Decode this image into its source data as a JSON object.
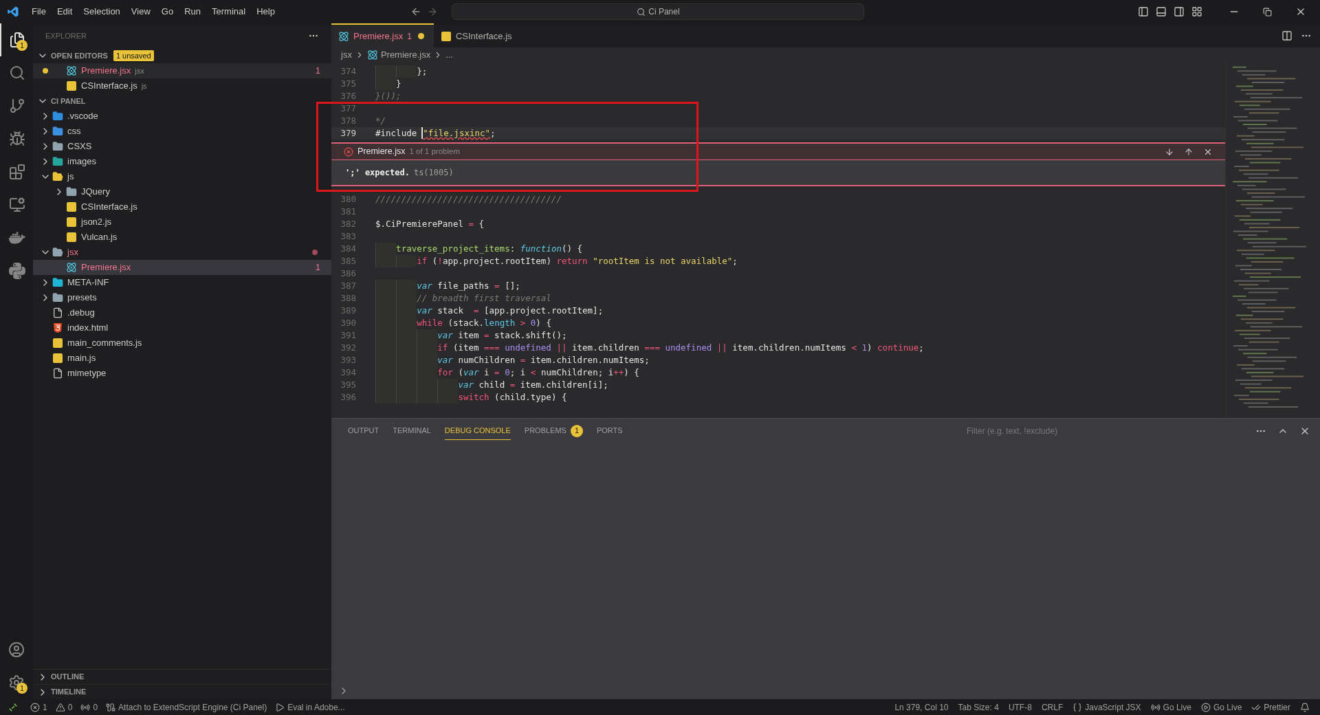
{
  "menu": [
    "File",
    "Edit",
    "Selection",
    "View",
    "Go",
    "Run",
    "Terminal",
    "Help"
  ],
  "search": "Ci Panel",
  "activity": [
    {
      "kind": "explorer",
      "selected": true,
      "badge": "1"
    },
    {
      "kind": "search",
      "selected": false
    },
    {
      "kind": "source-control",
      "selected": false
    },
    {
      "kind": "run",
      "selected": false
    },
    {
      "kind": "extensions",
      "selected": false
    },
    {
      "kind": "remote",
      "selected": false
    },
    {
      "kind": "docker",
      "selected": false
    },
    {
      "kind": "python",
      "selected": false
    }
  ],
  "activity_bottom": [
    {
      "kind": "account"
    },
    {
      "kind": "manage",
      "badge": "1"
    }
  ],
  "sidebar": {
    "title": "EXPLORER",
    "open_editors": {
      "label": "OPEN EDITORS",
      "badge": "1 unsaved",
      "expanded": true,
      "items": [
        {
          "name": "Premiere.jsx",
          "hint": "jsx",
          "kind": "react",
          "unsaved": true,
          "error": true,
          "count": "1",
          "selected": true
        },
        {
          "name": "CSInterface.js",
          "hint": "js",
          "kind": "js",
          "unsaved": false,
          "error": false,
          "selected": false
        }
      ]
    },
    "project": {
      "label": "CI PANEL",
      "expanded": true,
      "items": [
        {
          "name": ".vscode",
          "kind": "vscode-folder",
          "expanded": false,
          "selected": false
        },
        {
          "name": "css",
          "kind": "css-folder",
          "expanded": false,
          "selected": false
        },
        {
          "name": "CSXS",
          "kind": "folder",
          "expanded": false,
          "selected": false
        },
        {
          "name": "images",
          "kind": "images-folder",
          "expanded": false,
          "selected": false
        },
        {
          "name": "js",
          "kind": "js-folder",
          "expanded": true,
          "selected": false,
          "children": [
            {
              "name": "JQuery",
              "kind": "folder",
              "expanded": false,
              "selected": false
            },
            {
              "name": "CSInterface.js",
              "kind": "js",
              "selected": false
            },
            {
              "name": "json2.js",
              "kind": "js",
              "selected": false
            },
            {
              "name": "Vulcan.js",
              "kind": "js",
              "selected": false
            }
          ]
        },
        {
          "name": "jsx",
          "kind": "folder",
          "expanded": true,
          "selected": false,
          "error": true,
          "children": [
            {
              "name": "Premiere.jsx",
              "kind": "react",
              "selected": true,
              "error": true,
              "count": "1"
            }
          ]
        },
        {
          "name": "META-INF",
          "kind": "meta-folder",
          "expanded": false,
          "selected": false
        },
        {
          "name": "presets",
          "kind": "folder",
          "expanded": false,
          "selected": false
        },
        {
          "name": ".debug",
          "kind": "file",
          "selected": false
        },
        {
          "name": "index.html",
          "kind": "html",
          "selected": false
        },
        {
          "name": "main_comments.js",
          "kind": "js",
          "selected": false
        },
        {
          "name": "main.js",
          "kind": "js",
          "selected": false
        },
        {
          "name": "mimetype",
          "kind": "file",
          "selected": false
        }
      ]
    },
    "outline": "OUTLINE",
    "timeline": "TIMELINE"
  },
  "tabs": [
    {
      "label": "Premiere.jsx",
      "count": "1",
      "kind": "react",
      "selected": true,
      "error": true,
      "unsaved": true
    },
    {
      "label": "CSInterface.js",
      "kind": "js",
      "selected": false,
      "error": false,
      "unsaved": false
    }
  ],
  "breadcrumb": [
    {
      "label": "jsx"
    },
    {
      "label": "Premiere.jsx",
      "kind": "react"
    },
    {
      "label": "..."
    }
  ],
  "code_before": [
    {
      "n": "374",
      "tokens": [
        {
          "text": "        };",
          "kind": "punct"
        }
      ]
    },
    {
      "n": "375",
      "tokens": [
        {
          "text": "    }",
          "kind": "punct"
        }
      ]
    },
    {
      "n": "376",
      "tokens": [
        {
          "text": "}());",
          "kind": "comment"
        }
      ]
    },
    {
      "n": "377"
    },
    {
      "n": "378",
      "tokens": [
        {
          "text": "*/",
          "kind": "comment"
        }
      ]
    },
    {
      "n": "379",
      "current": true,
      "tokens": [
        {
          "text": "#include",
          "kind": "plain"
        },
        {
          "text": "\"file.jsxinc\"",
          "kind": "error-string"
        },
        {
          "text": ";",
          "kind": "punct"
        }
      ]
    }
  ],
  "peek": {
    "file": "Premiere.jsx",
    "count": "1 of 1 problem",
    "message": "';' expected.",
    "code": "ts(1005)"
  },
  "code_after": [
    {
      "n": "380",
      "tokens": [
        {
          "text": "////////////////////////////////////",
          "kind": "comment"
        }
      ]
    },
    {
      "n": "381"
    },
    {
      "n": "382",
      "tokens": [
        {
          "text": "$.CiPremierePanel",
          "kind": "plain"
        },
        {
          "text": " =",
          "kind": "op"
        },
        {
          "text": " {",
          "kind": "punct"
        }
      ]
    },
    {
      "n": "383"
    },
    {
      "n": "384",
      "tokens": [
        {
          "text": "    traverse_project_items",
          "kind": "prop"
        },
        {
          "text": ": ",
          "kind": "punct"
        },
        {
          "text": "function",
          "kind": "storage"
        },
        {
          "text": "() {",
          "kind": "punct"
        }
      ]
    },
    {
      "n": "385",
      "tokens": [
        {
          "text": "        if",
          "kind": "keyword"
        },
        {
          "text": " (",
          "kind": "punct"
        },
        {
          "text": "!",
          "kind": "op"
        },
        {
          "text": "app.project.rootItem) ",
          "kind": "plain"
        },
        {
          "text": "return",
          "kind": "keyword"
        },
        {
          "text": " \"rootItem is not available\"",
          "kind": "string"
        },
        {
          "text": ";",
          "kind": "punct"
        }
      ]
    },
    {
      "n": "386"
    },
    {
      "n": "387",
      "tokens": [
        {
          "text": "        var",
          "kind": "storage"
        },
        {
          "text": " file_paths",
          "kind": "plain"
        },
        {
          "text": " =",
          "kind": "op"
        },
        {
          "text": " [];",
          "kind": "punct"
        }
      ]
    },
    {
      "n": "388",
      "tokens": [
        {
          "text": "        // breadth first traversal",
          "kind": "comment"
        }
      ]
    },
    {
      "n": "389",
      "tokens": [
        {
          "text": "        var",
          "kind": "storage"
        },
        {
          "text": " stack ",
          "kind": "plain"
        },
        {
          "text": " =",
          "kind": "op"
        },
        {
          "text": " [app.project.rootItem];",
          "kind": "punct"
        }
      ]
    },
    {
      "n": "390",
      "tokens": [
        {
          "text": "        while",
          "kind": "keyword"
        },
        {
          "text": " (stack.",
          "kind": "plain"
        },
        {
          "text": "length",
          "kind": "support"
        },
        {
          "text": " >",
          "kind": "op"
        },
        {
          "text": " 0",
          "kind": "number"
        },
        {
          "text": ") {",
          "kind": "punct"
        }
      ]
    },
    {
      "n": "391",
      "tokens": [
        {
          "text": "            var",
          "kind": "storage"
        },
        {
          "text": " item",
          "kind": "plain"
        },
        {
          "text": " =",
          "kind": "op"
        },
        {
          "text": " stack.shift();",
          "kind": "plain"
        }
      ]
    },
    {
      "n": "392",
      "tokens": [
        {
          "text": "            if",
          "kind": "keyword"
        },
        {
          "text": " (item",
          "kind": "plain"
        },
        {
          "text": " ===",
          "kind": "op"
        },
        {
          "text": " undefined",
          "kind": "number"
        },
        {
          "text": " ||",
          "kind": "op"
        },
        {
          "text": " item.children",
          "kind": "plain"
        },
        {
          "text": " ===",
          "kind": "op"
        },
        {
          "text": " undefined",
          "kind": "number"
        },
        {
          "text": " ||",
          "kind": "op"
        },
        {
          "text": " item.children.numItems",
          "kind": "plain"
        },
        {
          "text": " <",
          "kind": "op"
        },
        {
          "text": " 1",
          "kind": "number"
        },
        {
          "text": ") ",
          "kind": "punct"
        },
        {
          "text": "continue",
          "kind": "keyword"
        },
        {
          "text": ";",
          "kind": "punct"
        }
      ]
    },
    {
      "n": "393",
      "tokens": [
        {
          "text": "            var",
          "kind": "storage"
        },
        {
          "text": " numChildren",
          "kind": "plain"
        },
        {
          "text": " =",
          "kind": "op"
        },
        {
          "text": " item.children.numItems;",
          "kind": "plain"
        }
      ]
    },
    {
      "n": "394",
      "tokens": [
        {
          "text": "            for",
          "kind": "keyword"
        },
        {
          "text": " (",
          "kind": "punct"
        },
        {
          "text": "var",
          "kind": "storage"
        },
        {
          "text": " i",
          "kind": "plain"
        },
        {
          "text": " =",
          "kind": "op"
        },
        {
          "text": " 0",
          "kind": "number"
        },
        {
          "text": "; i",
          "kind": "plain"
        },
        {
          "text": " <",
          "kind": "op"
        },
        {
          "text": " numChildren; i",
          "kind": "plain"
        },
        {
          "text": "++",
          "kind": "op"
        },
        {
          "text": ") {",
          "kind": "punct"
        }
      ]
    },
    {
      "n": "395",
      "tokens": [
        {
          "text": "                var",
          "kind": "storage"
        },
        {
          "text": " child",
          "kind": "plain"
        },
        {
          "text": " =",
          "kind": "op"
        },
        {
          "text": " item.children[i];",
          "kind": "plain"
        }
      ]
    },
    {
      "n": "396",
      "tokens": [
        {
          "text": "                switch",
          "kind": "keyword"
        },
        {
          "text": " (child.type) {",
          "kind": "plain"
        }
      ]
    }
  ],
  "panel": {
    "tabs": [
      {
        "label": "OUTPUT",
        "selected": false
      },
      {
        "label": "TERMINAL",
        "selected": false
      },
      {
        "label": "DEBUG CONSOLE",
        "selected": true
      },
      {
        "label": "PROBLEMS",
        "selected": false,
        "badge": "1"
      },
      {
        "label": "PORTS",
        "selected": false
      }
    ],
    "filter_placeholder": "Filter (e.g. text, !exclude)"
  },
  "status_bar": {
    "left": [
      {
        "kind": "error",
        "text": "1"
      },
      {
        "kind": "warning",
        "text": "0"
      },
      {
        "kind": "ports",
        "text": "0"
      },
      {
        "kind": "attach",
        "text": "Attach to ExtendScript Engine (Ci Panel)"
      },
      {
        "kind": "play",
        "text": "Eval in Adobe..."
      }
    ],
    "right": [
      {
        "text": "Ln 379, Col 10"
      },
      {
        "text": "Tab Size: 4"
      },
      {
        "text": "UTF-8"
      },
      {
        "text": "CRLF"
      },
      {
        "kind": "braces",
        "text": "JavaScript JSX"
      },
      {
        "kind": "broadcast",
        "text": "Go Live"
      },
      {
        "kind": "play-circle",
        "text": "Go Live"
      },
      {
        "kind": "checks",
        "text": "Prettier"
      },
      {
        "kind": "bell"
      }
    ]
  }
}
